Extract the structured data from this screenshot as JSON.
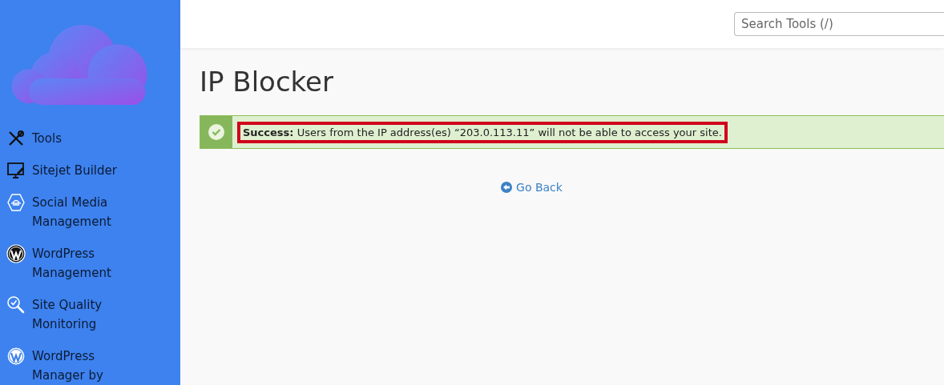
{
  "sidebar": {
    "items": [
      {
        "label": "Tools"
      },
      {
        "label": "Sitejet Builder"
      },
      {
        "label": "Social Media Management"
      },
      {
        "label": "WordPress Management"
      },
      {
        "label": "Site Quality Monitoring"
      },
      {
        "label": "WordPress Manager by"
      }
    ]
  },
  "search": {
    "placeholder": "Search Tools (/)"
  },
  "page": {
    "title": "IP Blocker",
    "alert": {
      "kind": "success",
      "highlighted": true,
      "text": "**Success:** Users from the IP address(es) “203.0.113.11” will not be able to access your site."
    },
    "back_link": "Go Back"
  }
}
